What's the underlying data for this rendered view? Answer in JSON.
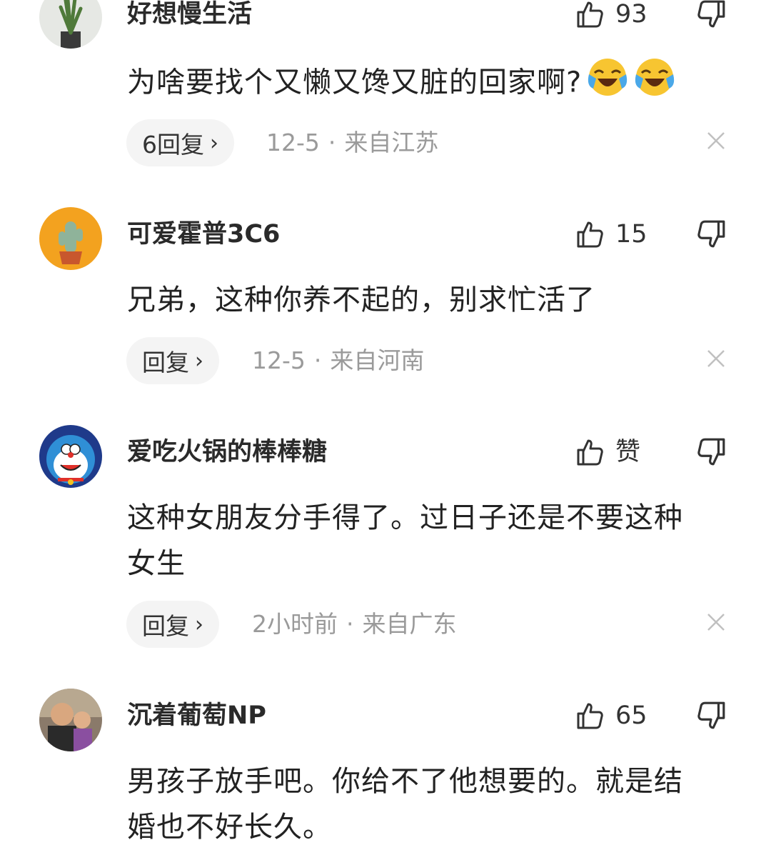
{
  "comments": [
    {
      "username": "好想慢生活",
      "likes": "93",
      "text": "为啥要找个又懒又馋又脏的回家啊?",
      "emojis": [
        "crying-laughing-emoji",
        "crying-laughing-emoji"
      ],
      "reply_label": "6回复",
      "date": "12-5",
      "location": "来自江苏",
      "avatar": "plant-avatar"
    },
    {
      "username": "可爱霍普3C6",
      "likes": "15",
      "text": "兄弟，这种你养不起的，别求忙活了",
      "reply_label": "回复",
      "date": "12-5",
      "location": "来自河南",
      "avatar": "cactus-avatar"
    },
    {
      "username": "爱吃火锅的棒棒糖",
      "likes": "赞",
      "text_lines": [
        "这种女朋友分手得了。过日子还是不要这种",
        "女生"
      ],
      "reply_label": "回复",
      "date": "2小时前",
      "location": "来自广东",
      "avatar": "doraemon-avatar"
    },
    {
      "username": "沉着葡萄NP",
      "likes": "65",
      "text_lines": [
        "男孩子放手吧。你给不了他想要的。就是结",
        "婚也不好长久。"
      ],
      "avatar": "family-photo-avatar"
    }
  ],
  "icons": {
    "like": "thumbs-up-icon",
    "dislike": "thumbs-down-icon",
    "chevron": "chevron-right-icon",
    "close": "close-icon"
  },
  "colors": {
    "text": "#222222",
    "meta": "#9a9a9a",
    "reply_bg": "#f4f4f4"
  }
}
